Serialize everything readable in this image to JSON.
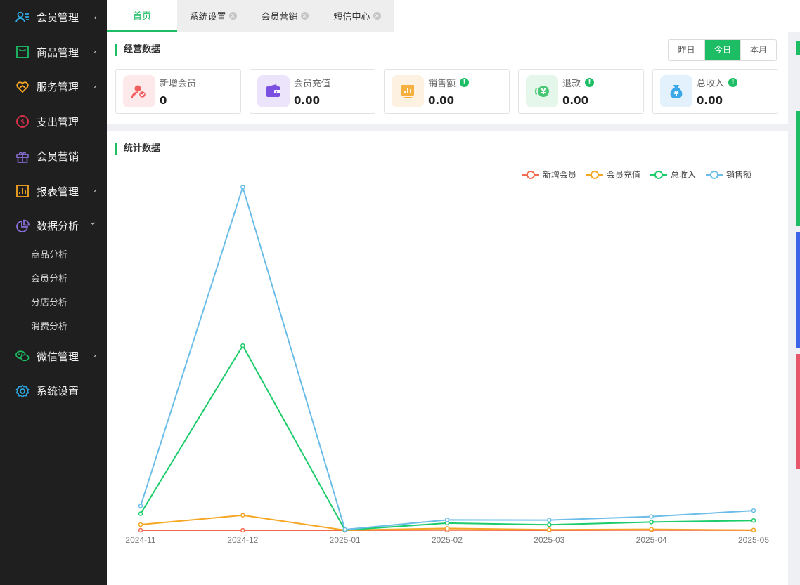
{
  "sidebar": {
    "items": [
      {
        "label": "会员管理",
        "icon": "member-icon",
        "color": "#2ea7e0"
      },
      {
        "label": "商品管理",
        "icon": "goods-icon",
        "color": "#1dbd65"
      },
      {
        "label": "服务管理",
        "icon": "service-icon",
        "color": "#f5a623"
      },
      {
        "label": "支出管理",
        "icon": "expense-icon",
        "color": "#e0334d"
      },
      {
        "label": "会员营销",
        "icon": "gift-icon",
        "color": "#8a6fd8"
      },
      {
        "label": "报表管理",
        "icon": "report-icon",
        "color": "#f5a623"
      },
      {
        "label": "数据分析",
        "icon": "pie-chart-icon",
        "color": "#8a6fd8"
      },
      {
        "label": "微信管理",
        "icon": "wechat-icon",
        "color": "#1dbd65"
      },
      {
        "label": "系统设置",
        "icon": "gear-icon",
        "color": "#2ea7e0"
      }
    ],
    "subitems": [
      "商品分析",
      "会员分析",
      "分店分析",
      "消费分析"
    ]
  },
  "tabs": [
    {
      "label": "首页",
      "closable": false
    },
    {
      "label": "系统设置",
      "closable": true
    },
    {
      "label": "会员营销",
      "closable": true
    },
    {
      "label": "短信中心",
      "closable": true
    }
  ],
  "ops": {
    "title": "经营数据",
    "periods": [
      "昨日",
      "今日",
      "本月"
    ],
    "active_period": "今日",
    "cards": [
      {
        "label": "新增会员",
        "value": "0",
        "icon": "new-member-icon",
        "bg": "#fde9e9",
        "color": "#f25d5d",
        "info": false
      },
      {
        "label": "会员充值",
        "value": "0.00",
        "icon": "wallet-icon",
        "bg": "#ebe4fb",
        "color": "#7b4fe0",
        "info": false
      },
      {
        "label": "销售额",
        "value": "0.00",
        "icon": "sales-chart-icon",
        "bg": "#fdf1e1",
        "color": "#f5b040",
        "info": true
      },
      {
        "label": "退款",
        "value": "0.00",
        "icon": "refund-icon",
        "bg": "#e5f6ea",
        "color": "#48c774",
        "info": true
      },
      {
        "label": "总收入",
        "value": "0.00",
        "icon": "money-bag-icon",
        "bg": "#e2f1fb",
        "color": "#3aa8e8",
        "info": true
      }
    ]
  },
  "stats": {
    "title": "统计数据"
  },
  "chart_data": {
    "type": "line",
    "categories": [
      "2024-11",
      "2024-12",
      "2025-01",
      "2025-02",
      "2025-03",
      "2025-04",
      "2025-05"
    ],
    "series": [
      {
        "name": "新增会员",
        "color": "#f26b4f",
        "values": [
          0,
          0,
          0,
          1,
          0,
          1,
          0
        ]
      },
      {
        "name": "会员充值",
        "color": "#f5a623",
        "values": [
          30,
          80,
          0,
          10,
          3,
          5,
          1
        ]
      },
      {
        "name": "总收入",
        "color": "#1ccb6a",
        "values": [
          88,
          990,
          1,
          38,
          29,
          44,
          52
        ]
      },
      {
        "name": "销售额",
        "color": "#6cbde8",
        "values": [
          130,
          1840,
          4,
          55,
          54,
          73,
          105
        ]
      }
    ],
    "ylim": [
      0,
      2000
    ],
    "legend": "top-right",
    "grid": false
  }
}
